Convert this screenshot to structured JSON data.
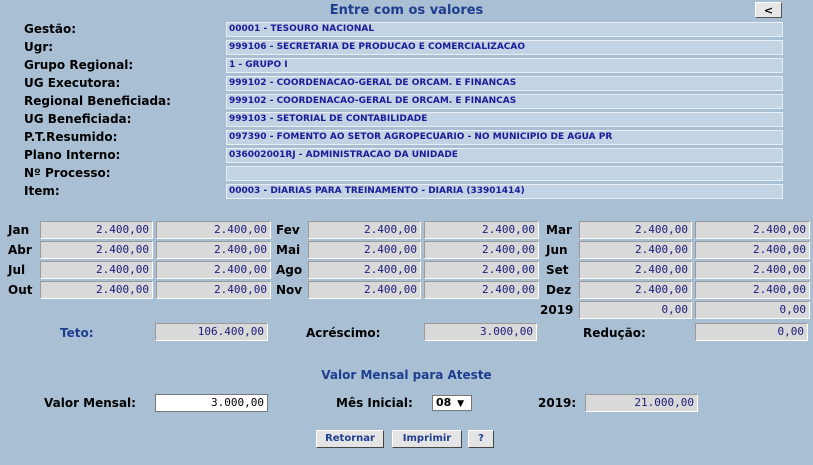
{
  "title": "Entre com os valores",
  "back_label": "<",
  "fields": [
    {
      "label": "Gestão:",
      "value": "00001 - TESOURO NACIONAL"
    },
    {
      "label": "Ugr:",
      "value": "999106 - SECRETARIA DE PRODUCAO E COMERCIALIZACAO"
    },
    {
      "label": "Grupo Regional:",
      "value": "1 - GRUPO I"
    },
    {
      "label": "UG Executora:",
      "value": "999102 - COORDENACAO-GERAL DE ORCAM. E FINANCAS"
    },
    {
      "label": "Regional Beneficiada:",
      "value": "999102 - COORDENACAO-GERAL DE ORCAM. E FINANCAS"
    },
    {
      "label": "UG Beneficiada:",
      "value": "999103 - SETORIAL DE CONTABILIDADE"
    },
    {
      "label": "P.T.Resumido:",
      "value": "097390 - FOMENTO AO SETOR AGROPECUARIO - NO MUNICIPIO DE AGUA PR"
    },
    {
      "label": "Plano Interno:",
      "value": "036002001RJ - ADMINISTRACAO DA UNIDADE"
    },
    {
      "label": "Nº Processo:",
      "value": ""
    },
    {
      "label": "Item:",
      "value": "00003 - DIARIAS PARA TREINAMENTO - DIARIA (33901414)"
    }
  ],
  "months": [
    {
      "label": "Jan",
      "a": "2.400,00",
      "b": "2.400,00"
    },
    {
      "label": "Abr",
      "a": "2.400,00",
      "b": "2.400,00"
    },
    {
      "label": "Jul",
      "a": "2.400,00",
      "b": "2.400,00"
    },
    {
      "label": "Out",
      "a": "2.400,00",
      "b": "2.400,00"
    },
    {
      "label": "Fev",
      "a": "2.400,00",
      "b": "2.400,00"
    },
    {
      "label": "Mai",
      "a": "2.400,00",
      "b": "2.400,00"
    },
    {
      "label": "Ago",
      "a": "2.400,00",
      "b": "2.400,00"
    },
    {
      "label": "Nov",
      "a": "2.400,00",
      "b": "2.400,00"
    },
    {
      "label": "Mar",
      "a": "2.400,00",
      "b": "2.400,00"
    },
    {
      "label": "Jun",
      "a": "2.400,00",
      "b": "2.400,00"
    },
    {
      "label": "Set",
      "a": "2.400,00",
      "b": "2.400,00"
    },
    {
      "label": "Dez",
      "a": "2.400,00",
      "b": "2.400,00"
    },
    {
      "label": "2019",
      "a": "0,00",
      "b": "0,00"
    }
  ],
  "totals": {
    "teto_label": "Teto:",
    "teto_value": "106.400,00",
    "acrescimo_label": "Acréscimo:",
    "acrescimo_value": "3.000,00",
    "reducao_label": "Redução:",
    "reducao_value": "0,00"
  },
  "ateste": {
    "title": "Valor Mensal para Ateste",
    "valor_label": "Valor Mensal:",
    "valor_value": "3.000,00",
    "mes_label": "Mês Inicial:",
    "mes_value": "08",
    "year_label": "2019:",
    "year_value": "21.000,00"
  },
  "buttons": {
    "retornar": "Retornar",
    "imprimir": "Imprimir",
    "help": "?"
  }
}
